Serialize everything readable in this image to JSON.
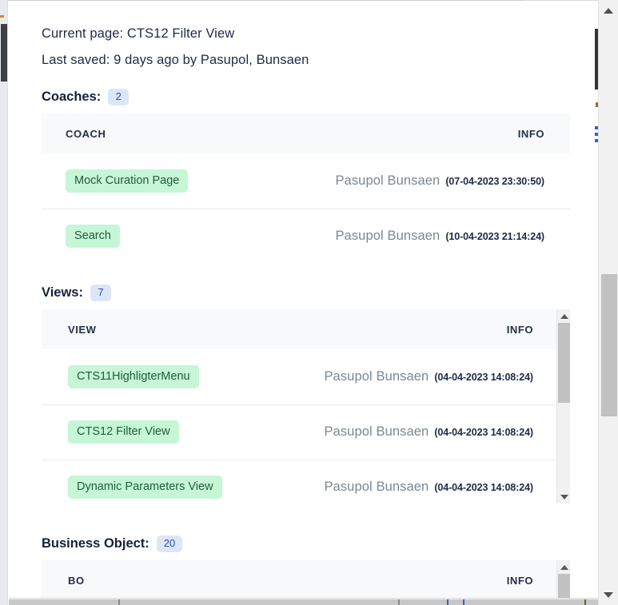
{
  "header": {
    "current_page_label": "Current page: CTS12 Filter View",
    "last_saved_label": "Last saved: 9 days ago by Pasupol, Bunsaen"
  },
  "sections": [
    {
      "id": "coaches",
      "title": "Coaches:",
      "count": "2",
      "columns": {
        "name": "COACH",
        "info": "INFO"
      },
      "rows": [
        {
          "name": "Mock Curation Page",
          "who": "Pasupol Bunsaen",
          "when": "(07-04-2023 23:30:50)"
        },
        {
          "name": "Search",
          "who": "Pasupol Bunsaen",
          "when": "(10-04-2023 21:14:24)"
        }
      ]
    },
    {
      "id": "views",
      "title": "Views:",
      "count": "7",
      "columns": {
        "name": "VIEW",
        "info": "INFO"
      },
      "rows": [
        {
          "name": "CTS11HighligterMenu",
          "who": "Pasupol Bunsaen",
          "when": "(04-04-2023 14:08:24)"
        },
        {
          "name": "CTS12 Filter View",
          "who": "Pasupol Bunsaen",
          "when": "(04-04-2023 14:08:24)"
        },
        {
          "name": "Dynamic Parameters View",
          "who": "Pasupol Bunsaen",
          "when": "(04-04-2023 14:08:24)"
        }
      ]
    },
    {
      "id": "business-object",
      "title": "Business Object:",
      "count": "20",
      "columns": {
        "name": "BO",
        "info": "INFO"
      },
      "rows": []
    }
  ],
  "colors": {
    "name_badge_bg": "#c6f6d5",
    "name_badge_text": "#1d5e3c",
    "count_badge_bg": "#dde6f8",
    "count_badge_text": "#2a4db5",
    "table_header_bg": "#f7f9fb",
    "row_divider": "#e9ebee",
    "who_text": "#7b8794",
    "heading_text": "#16203a",
    "scrollbar_thumb": "#c1c1c1",
    "scrollbar_track": "#f1f1f1"
  },
  "icons": {
    "scroll_up": "scroll-up-arrow-icon",
    "scroll_down": "scroll-down-arrow-icon"
  }
}
